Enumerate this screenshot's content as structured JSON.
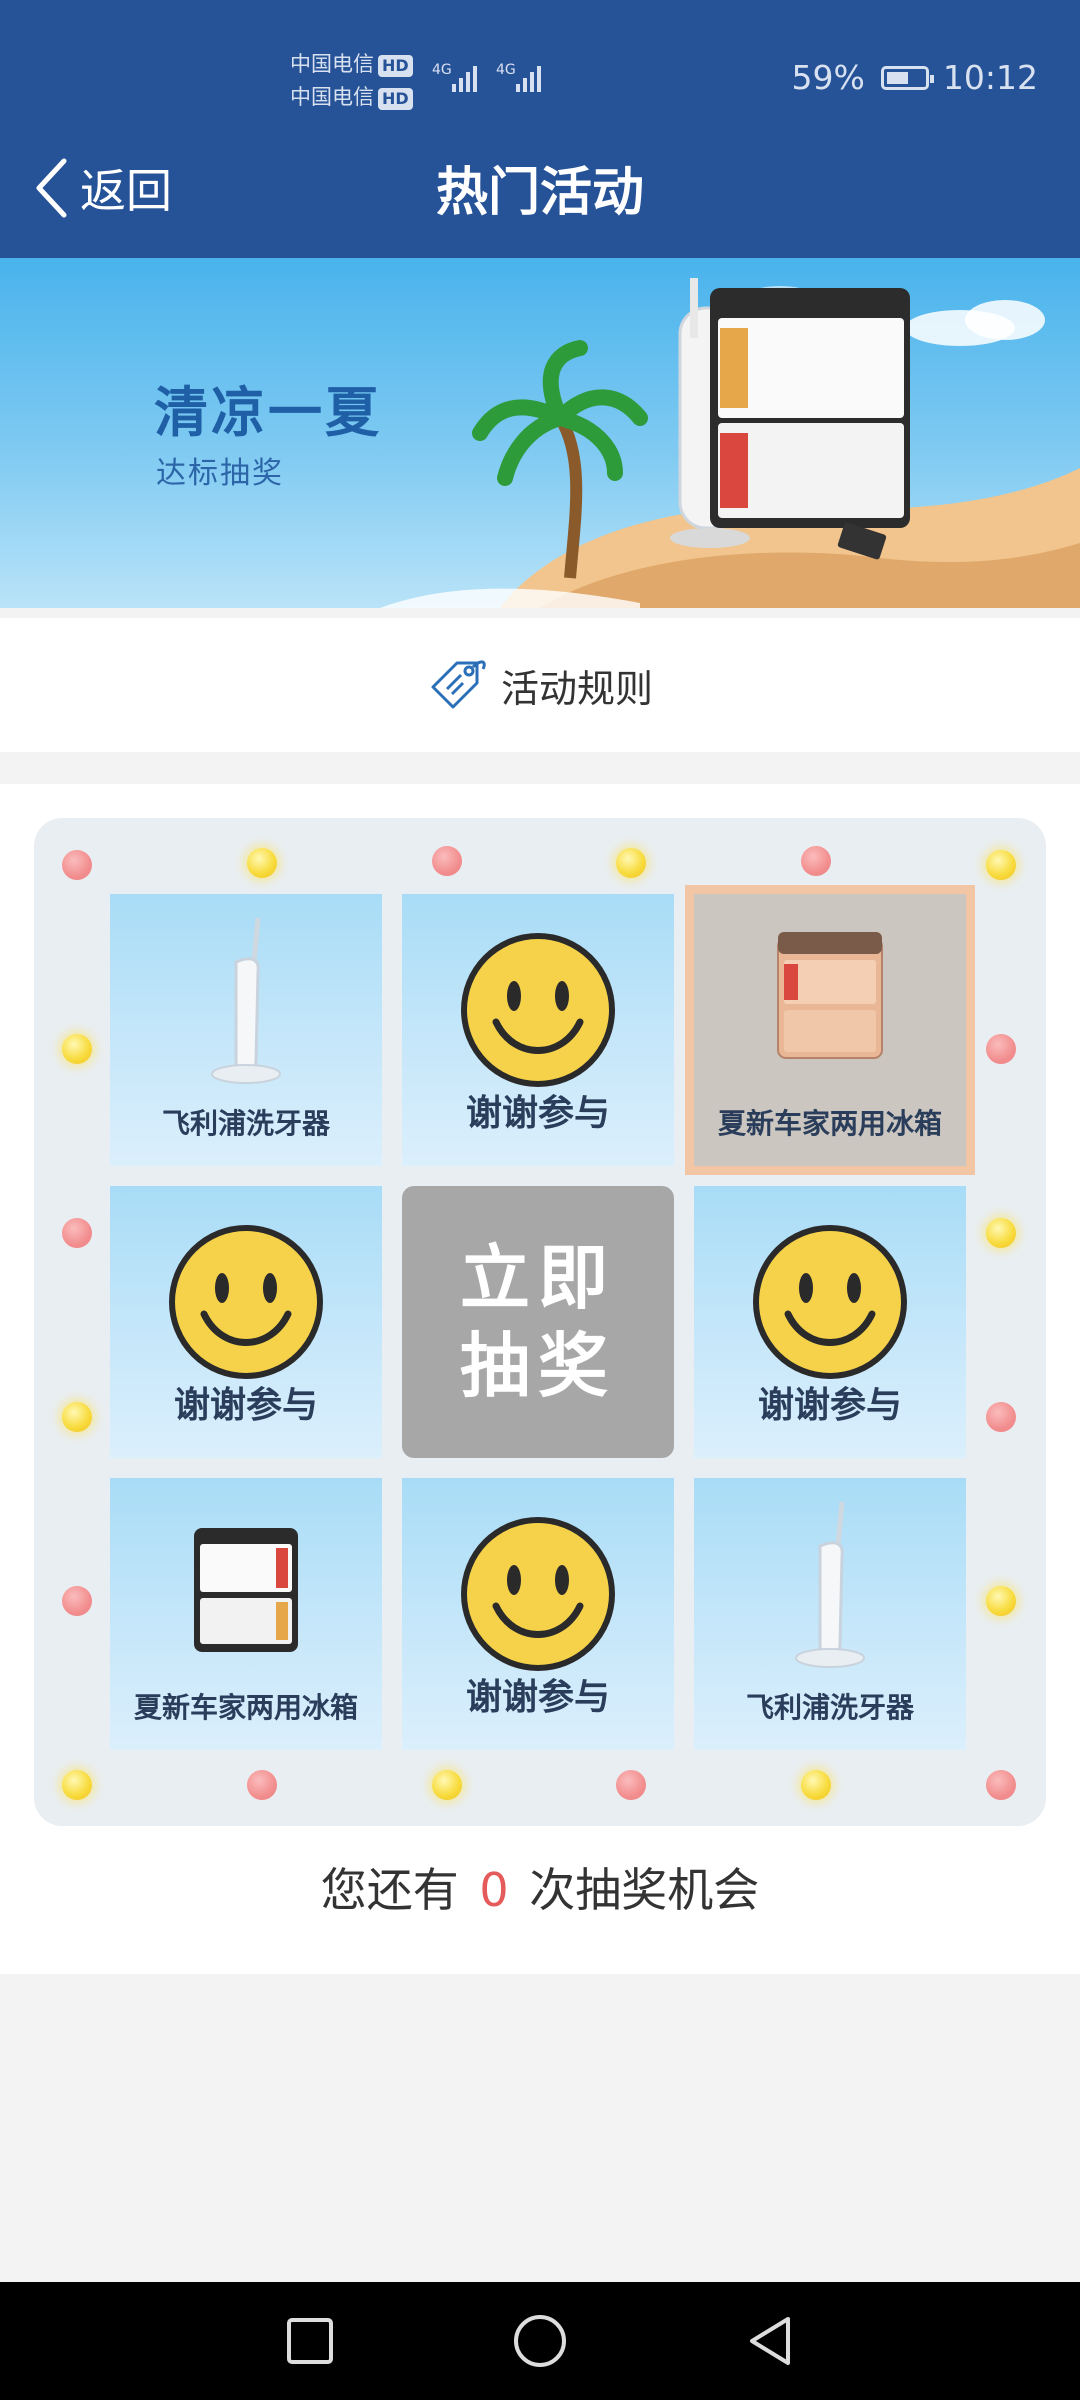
{
  "status_bar": {
    "carrier_1": "中国电信",
    "carrier_2": "中国电信",
    "hd_badge": "HD",
    "network": "4G",
    "battery": "59%",
    "battery_level": 0.59,
    "time": "10:12"
  },
  "header": {
    "back_label": "返回",
    "title": "热门活动"
  },
  "banner": {
    "title": "清凉一夏",
    "subtitle": "达标抽奖"
  },
  "rules": {
    "label": "活动规则",
    "icon": "tag-icon"
  },
  "lottery": {
    "cells": [
      {
        "label": "飞利浦洗牙器",
        "type": "prize",
        "icon": "water-flosser-icon",
        "highlighted": false
      },
      {
        "label": "谢谢参与",
        "type": "thanks",
        "icon": "smiley-icon",
        "highlighted": false
      },
      {
        "label": "夏新车家两用冰箱",
        "type": "prize",
        "icon": "fridge-icon",
        "highlighted": true
      },
      {
        "label": "谢谢参与",
        "type": "thanks",
        "icon": "smiley-icon",
        "highlighted": false
      },
      {
        "label": "谢谢参与",
        "type": "thanks",
        "icon": "smiley-icon",
        "highlighted": false
      },
      {
        "label": "夏新车家两用冰箱",
        "type": "prize",
        "icon": "fridge-icon",
        "highlighted": false
      },
      {
        "label": "谢谢参与",
        "type": "thanks",
        "icon": "smiley-icon",
        "highlighted": false
      },
      {
        "label": "飞利浦洗牙器",
        "type": "prize",
        "icon": "water-flosser-icon",
        "highlighted": false
      }
    ],
    "draw_button": {
      "line1": "立即",
      "line2": "抽奖"
    },
    "chance_prefix": "您还有",
    "chance_count": "0",
    "chance_suffix": "次抽奖机会"
  },
  "nav": {
    "recent_icon": "square-icon",
    "home_icon": "circle-icon",
    "back_icon": "triangle-back-icon"
  },
  "colors": {
    "header_bg": "#265297",
    "draw_button": "#a7a7a7",
    "highlight_border": "#f2c5a4",
    "chance_number": "#e55a5a"
  }
}
